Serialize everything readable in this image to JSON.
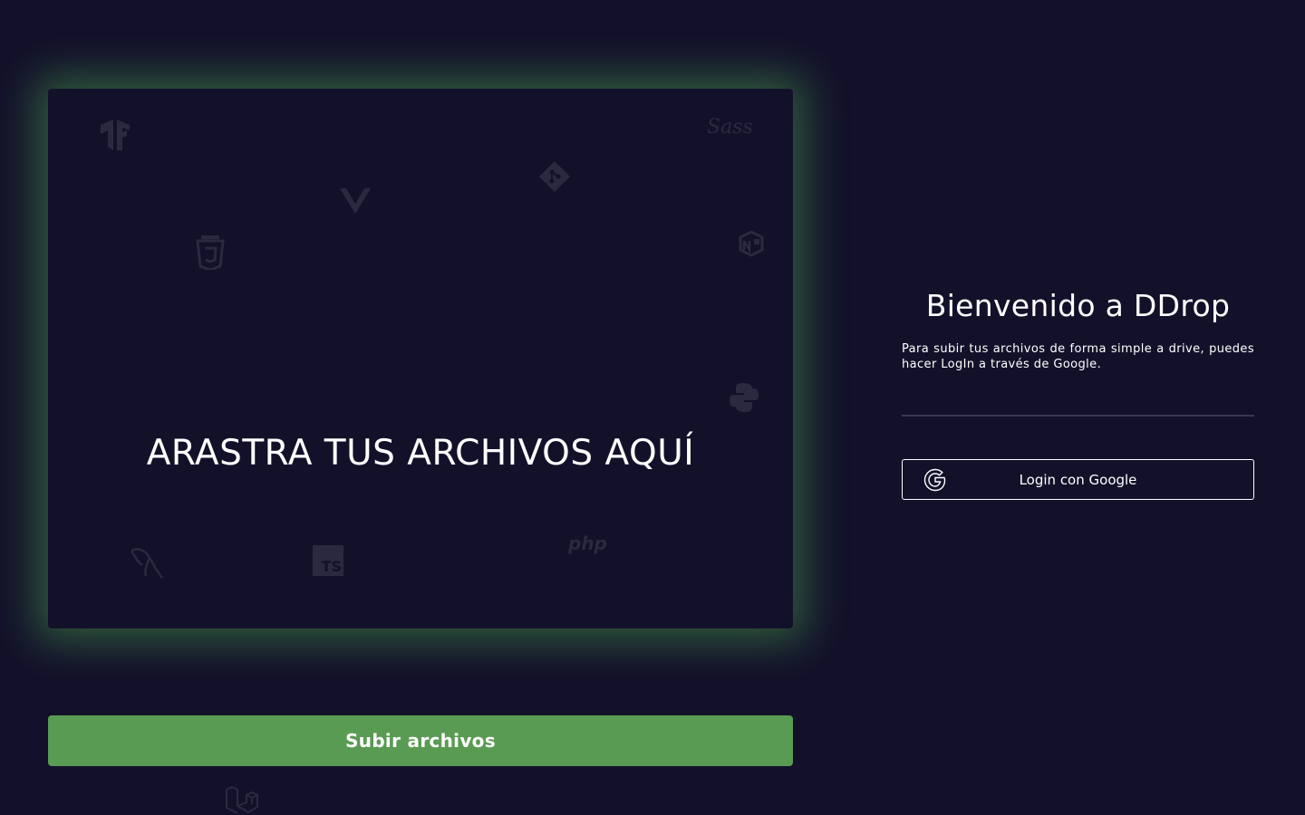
{
  "dropzone": {
    "instruction": "ARASTRA TUS ARCHIVOS AQUÍ",
    "background_icons": [
      "tensorflow-icon",
      "vue-icon",
      "css3-icon",
      "git-icon",
      "sass-icon",
      "numpy-icon",
      "python-icon",
      "mysql-icon",
      "typescript-icon",
      "php-icon"
    ],
    "icon_texts": {
      "php": "php",
      "ts": "TS",
      "sass": "Sass"
    }
  },
  "upload": {
    "label": "Subir archivos"
  },
  "sidebar": {
    "title": "Bienvenido a DDrop",
    "description": "Para subir tus archivos de forma simple a drive, puedes hacer LogIn a través de Google.",
    "google_button_label": "Login con Google"
  },
  "colors": {
    "background": "#13112a",
    "accent_green": "#599b52",
    "text": "#ffffff"
  }
}
